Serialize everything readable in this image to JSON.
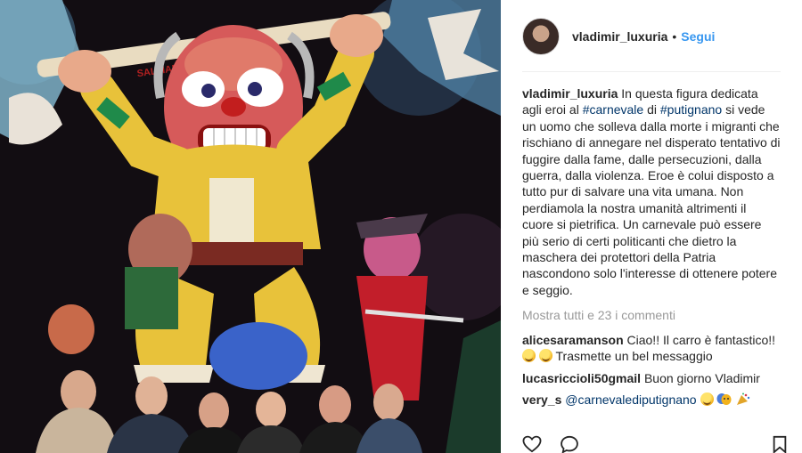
{
  "post": {
    "username": "vladimir_luxuria",
    "follow_label": "Segui",
    "separator": "•"
  },
  "caption": {
    "username": "vladimir_luxuria",
    "part1": "In questa figura dedicata agli eroi al ",
    "tag1": "#carnevale",
    "part2": " di ",
    "tag2": "#putignano",
    "part3": " si vede un uomo che solleva dalla morte i migranti che rischiano di annegare nel disperato tentativo di fuggire dalla fame, dalle persecuzioni, dalla guerra, dalla violenza. Eroe è colui disposto a tutto pur di salvare una vita umana. Non perdiamola la nostra umanità altrimenti il cuore si pietrifica. Un carnevale può essere più serio di certi politicanti che dietro la maschera dei protettori della Patria nascondono solo l'interesse di ottenere potere e seggio."
  },
  "view_all_comments": "Mostra tutti e 23 i commenti",
  "comments": [
    {
      "username": "alicesaramanson",
      "text_before": "Ciao!! Il carro è fantastico!!",
      "text_after": " Trasmette un bel messaggio"
    },
    {
      "username": "lucasriccioli50gmail",
      "text": "Buon giorno Vladimir"
    },
    {
      "username": "very_s",
      "mention": "@carnevalediputignano"
    }
  ],
  "photo": {
    "banner_text": "SALVIAMO MIGRANTI"
  },
  "icons": [
    "heart-icon",
    "comment-icon",
    "bookmark-icon",
    "smiling-face-icon",
    "theater-masks-icon",
    "party-popper-icon"
  ]
}
